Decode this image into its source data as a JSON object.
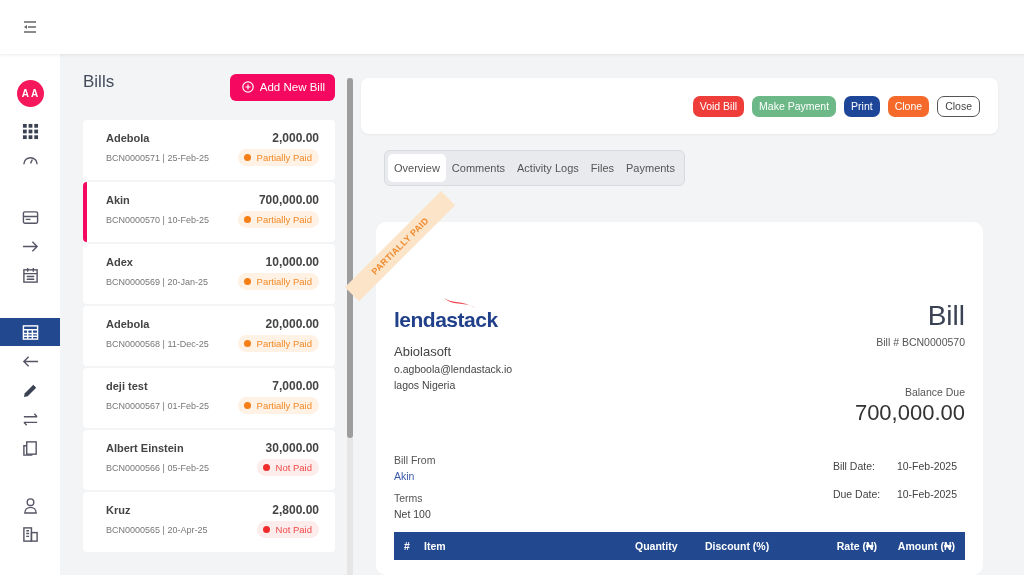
{
  "sidebar": {
    "avatar": "A A",
    "groups": [
      [
        {
          "kind": "grid",
          "selected": false
        },
        {
          "kind": "gauge",
          "selected": false
        }
      ],
      [
        {
          "kind": "card",
          "selected": false
        },
        {
          "kind": "arrow-right",
          "selected": false
        },
        {
          "kind": "calendar",
          "selected": false
        }
      ],
      [
        {
          "kind": "table",
          "selected": true
        },
        {
          "kind": "arrow-left",
          "selected": false
        },
        {
          "kind": "pencil",
          "selected": false
        },
        {
          "kind": "swap",
          "selected": false
        },
        {
          "kind": "files",
          "selected": false
        }
      ],
      [
        {
          "kind": "user",
          "selected": false
        },
        {
          "kind": "building",
          "selected": false
        }
      ]
    ]
  },
  "bills": {
    "title": "Bills",
    "add_button": "Add New Bill",
    "items": [
      {
        "name": "Adebola",
        "amount": "2,000.00",
        "meta": "BCN0000571 | 25-Feb-25",
        "status": "Partially Paid",
        "kind": "partial",
        "selected": false
      },
      {
        "name": "Akin",
        "amount": "700,000.00",
        "meta": "BCN0000570 | 10-Feb-25",
        "status": "Partially Paid",
        "kind": "partial",
        "selected": true
      },
      {
        "name": "Adex",
        "amount": "10,000.00",
        "meta": "BCN0000569 | 20-Jan-25",
        "status": "Partially Paid",
        "kind": "partial",
        "selected": false
      },
      {
        "name": "Adebola",
        "amount": "20,000.00",
        "meta": "BCN0000568 | 11-Dec-25",
        "status": "Partially Paid",
        "kind": "partial",
        "selected": false
      },
      {
        "name": "deji test",
        "amount": "7,000.00",
        "meta": "BCN0000567 | 01-Feb-25",
        "status": "Partially Paid",
        "kind": "partial",
        "selected": false
      },
      {
        "name": "Albert Einstein",
        "amount": "30,000.00",
        "meta": "BCN0000566 | 05-Feb-25",
        "status": "Not Paid",
        "kind": "unpaid",
        "selected": false
      },
      {
        "name": "Kruz",
        "amount": "2,800.00",
        "meta": "BCN0000565 | 20-Apr-25",
        "status": "Not Paid",
        "kind": "unpaid",
        "selected": false
      }
    ]
  },
  "actions": [
    {
      "label": "Void Bill",
      "kind": "danger"
    },
    {
      "label": "Make Payment",
      "kind": "success"
    },
    {
      "label": "Print",
      "kind": "primary"
    },
    {
      "label": "Clone",
      "kind": "warning"
    },
    {
      "label": "Close",
      "kind": "outline"
    }
  ],
  "tabs": [
    {
      "label": "Overview",
      "selected": true
    },
    {
      "label": "Comments",
      "selected": false
    },
    {
      "label": "Activity Logs",
      "selected": false
    },
    {
      "label": "Files",
      "selected": false
    },
    {
      "label": "Payments",
      "selected": false
    }
  ],
  "bill": {
    "ribbon": "PARTIALLY PAID",
    "logo": "lendastack",
    "title": "Bill",
    "company": "Abiolasoft",
    "email": "o.agboola@lendastack.io",
    "address": "lagos Nigeria",
    "number": "Bill # BCN0000570",
    "balance_label": "Balance Due",
    "balance": "700,000.00",
    "bill_from_label": "Bill From",
    "bill_from": "Akin",
    "terms_label": "Terms",
    "terms": "Net 100",
    "dates": [
      {
        "label": "Bill Date:",
        "value": "10-Feb-2025"
      },
      {
        "label": "Due Date:",
        "value": "10-Feb-2025"
      }
    ],
    "table": {
      "columns": [
        "#",
        "Item",
        "Quantity",
        "Discount (%)",
        "Rate (₦)",
        "Amount (₦)"
      ]
    }
  }
}
